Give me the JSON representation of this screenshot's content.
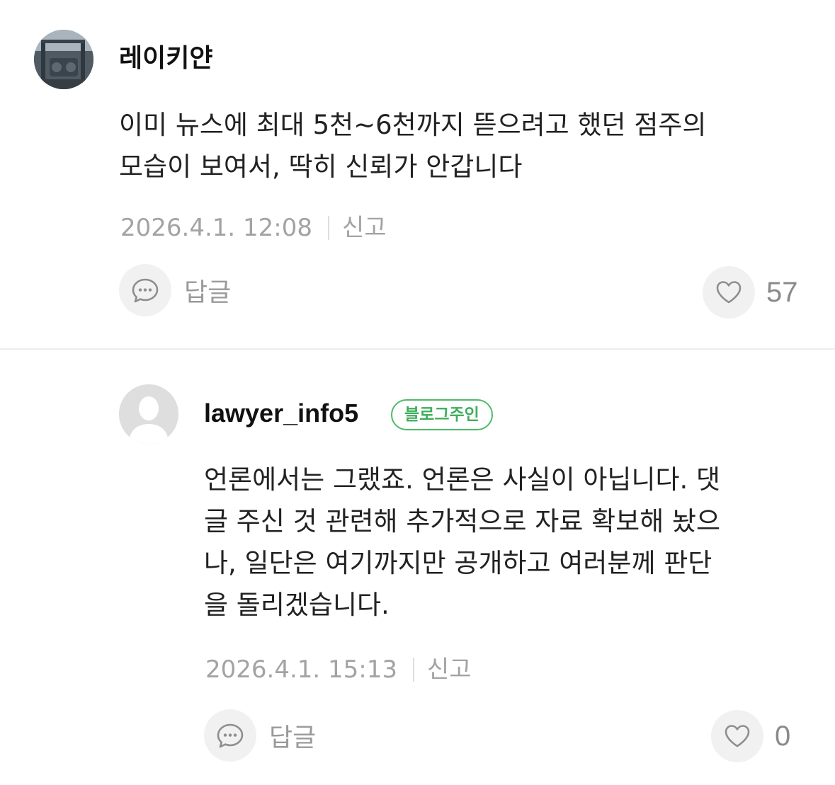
{
  "comments": [
    {
      "username": "레이키얀",
      "body_lines": [
        "이미 뉴스에 최대 5천~6천까지 뜯으려고 했던 점주의",
        "모습이 보여서, 딱히 신뢰가 안갑니다"
      ],
      "timestamp": "2026.4.1. 12:08",
      "report_label": "신고",
      "reply_label": "답글",
      "like_count": "57",
      "avatar_icon": "photo-avatar"
    },
    {
      "username": "lawyer_info5",
      "badge": "블로그주인",
      "body_lines": [
        "언론에서는 그랬죠. 언론은 사실이 아닙니다. 댓",
        "글 주신 것 관련해 추가적으로 자료 확보해 놨으",
        "나, 일단은 여기까지만 공개하고 여러분께 판단",
        "을 돌리겠습니다."
      ],
      "timestamp": "2026.4.1. 15:13",
      "report_label": "신고",
      "reply_label": "답글",
      "like_count": "0",
      "avatar_icon": "default-person-avatar"
    }
  ],
  "colors": {
    "badge_green": "#4dbb68",
    "meta_gray": "#a3a3a3",
    "button_bg": "#f1f1f1"
  },
  "icons": {
    "reply": "speech-bubble-icon",
    "like": "heart-outline-icon"
  }
}
